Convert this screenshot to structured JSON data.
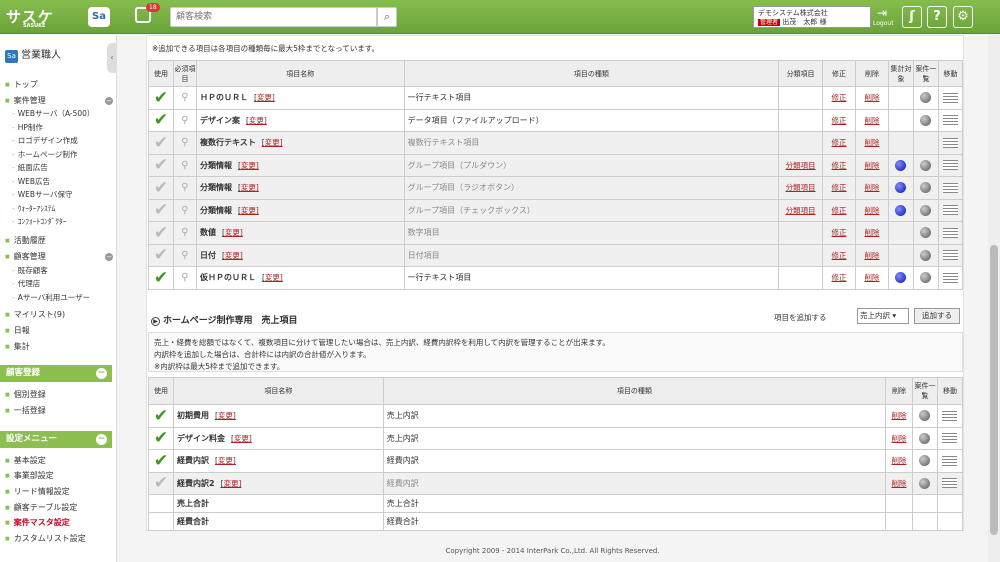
{
  "header": {
    "logo": "サスケ",
    "logo_sub": "SASUKE",
    "app_badge": "Sa",
    "notif_count": "18",
    "search_placeholder": "顧客検索",
    "company": "デモシステム株式会社",
    "role": "管理者",
    "user": "出茂　太郎 様",
    "logout": "Logout"
  },
  "sidebar": {
    "title": "営業職人",
    "items": {
      "top": "トップ",
      "anken": "案件管理",
      "web": "WEBサーバ（A-500）",
      "hp": "HP制作",
      "logo": "ロゴデザイン作成",
      "home": "ホームページ制作",
      "print": "紙面広告",
      "webad": "WEB広告",
      "webhosyu": "WEBサーバ保守",
      "water": "ｳｫｰﾀｰｱｼｽﾃﾑ",
      "comfort": "ｺﾝﾌｫｰﾄｺﾝﾀﾞｸﾀｰ",
      "katsudo": "活動履歴",
      "kokyaku": "顧客管理",
      "kizon": "既存顧客",
      "dairi": "代理店",
      "aserver": "Aサーバ利用ユーザー",
      "mylist": "マイリスト(9)",
      "nippo": "日報",
      "shukei": "集計"
    },
    "reg_head": "顧客登録",
    "reg": [
      "個別登録",
      "一括登録"
    ],
    "set_head": "設定メニュー",
    "set": [
      "基本設定",
      "事業部設定",
      "リード情報設定",
      "顧客テーブル設定",
      "案件マスタ設定",
      "カスタムリスト設定"
    ]
  },
  "notes": {
    "n1": "※追加できる項目は各項目の種類毎に最大5枠までとなっています。"
  },
  "t1": {
    "headers": {
      "use": "使用",
      "req": "必須項目",
      "name": "項目名称",
      "type": "項目の種類",
      "bunrui": "分類項目",
      "edit": "修正",
      "del": "削除",
      "agg": "集計対象",
      "list": "案件一覧",
      "move": "移動"
    },
    "change": "変更]",
    "link_bunrui": "分類項目",
    "link_edit": "修正",
    "link_del": "削除",
    "rows": [
      {
        "name": "ＨＰのＵＲＬ",
        "type": "一行テキスト項目"
      },
      {
        "name": "デザイン案",
        "type": "データ項目（ファイルアップロード）"
      },
      {
        "name": "複数行テキスト",
        "type": "複数行テキスト項目"
      },
      {
        "name": "分類情報",
        "type": "グループ項目（プルダウン）"
      },
      {
        "name": "分類情報",
        "type": "グループ項目（ラジオボタン）"
      },
      {
        "name": "分類情報",
        "type": "グループ項目（チェックボックス）"
      },
      {
        "name": "数値",
        "type": "数字項目"
      },
      {
        "name": "日付",
        "type": "日付項目"
      },
      {
        "name": "仮ＨＰのＵＲＬ",
        "type": "一行テキスト項目"
      }
    ]
  },
  "sec2": {
    "title": "ホームページ制作専用　売上項目",
    "add_label": "項目を追加する",
    "select": "売上内訳 ▾",
    "add_btn": "追加する",
    "desc": [
      "売上・経費を総額ではなくて、複数項目に分けて管理したい場合は、売上内訳、経費内訳枠を利用して内訳を管理することが出来ます。",
      "内訳枠を追加した場合は、合計枠には内訳の合計値が入ります。",
      "※内訳枠は最大5枠まで追加できます。"
    ]
  },
  "t2": {
    "headers": {
      "use": "使用",
      "name": "項目名称",
      "type": "項目の種類",
      "del": "削除",
      "list": "案件一覧",
      "move": "移動"
    },
    "rows": [
      {
        "name": "初期費用",
        "type": "売上内訳"
      },
      {
        "name": "デザイン料金",
        "type": "売上内訳"
      },
      {
        "name": "経費内訳",
        "type": "経費内訳"
      },
      {
        "name": "経費内訳2",
        "type": "経費内訳"
      },
      {
        "name": "売上合計",
        "type": "売上合計"
      },
      {
        "name": "経費合計",
        "type": "経費合計"
      }
    ]
  },
  "footer": "Copyright 2009 - 2014 InterPark Co.,Ltd. All Rights Reserved."
}
